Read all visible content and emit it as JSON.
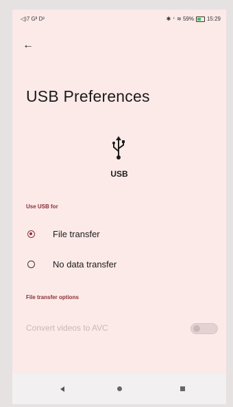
{
  "status_bar": {
    "left_text": "◁)7 Gᴵᴵ D²",
    "right_text": "✱ ⁺ ≋ 59%",
    "time": "15:29",
    "battery_level": 0.59
  },
  "header": {
    "back_icon": "arrow-back-icon",
    "title": "USB Preferences"
  },
  "device": {
    "icon": "usb-icon",
    "label": "USB"
  },
  "use_usb_for": {
    "header": "Use USB for",
    "options": [
      {
        "label": "File transfer",
        "selected": true
      },
      {
        "label": "No data transfer",
        "selected": false
      }
    ]
  },
  "file_transfer_options": {
    "header": "File transfer options",
    "convert_label": "Convert videos to AVC",
    "convert_enabled": false,
    "convert_on": false
  },
  "nav_bar": {
    "back_icon": "nav-back-icon",
    "home_icon": "nav-home-icon",
    "recents_icon": "nav-recents-icon"
  },
  "colors": {
    "background": "#fbeae8",
    "accent": "#8a2f36",
    "disabled_text": "#c6b9b8"
  }
}
